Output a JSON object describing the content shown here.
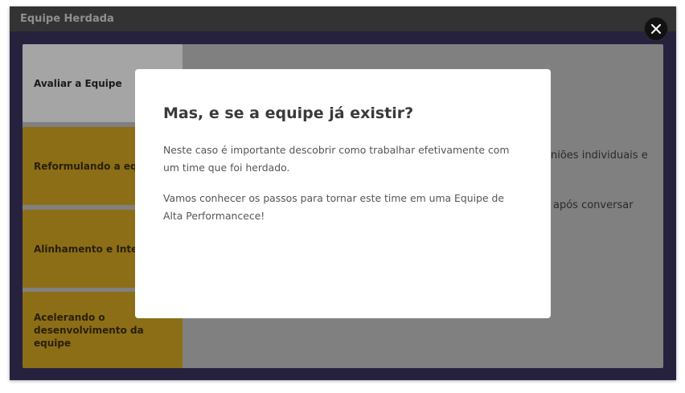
{
  "window": {
    "title": "Equipe Herdada"
  },
  "tabs": [
    {
      "label": "Avaliar a Equipe",
      "state": "active"
    },
    {
      "label": "Reformulando a equipe",
      "state": "inactive"
    },
    {
      "label": "Alinhamento e Integração",
      "state": "inactive"
    },
    {
      "label": "Acelerando o desenvolvimento da equipe",
      "state": "inactive"
    }
  ],
  "background_text": {
    "line1": "niões individuais e",
    "line2": "após conversar"
  },
  "modal": {
    "heading": "Mas, e se a equipe já existir?",
    "paragraph1": "Neste caso é  importante descobrir como trabalhar efetivamente com um time que foi herdado.",
    "paragraph2": "Vamos conhecer os passos para tornar este time em uma Equipe de Alta Performancece!"
  },
  "close": {
    "icon": "close-icon"
  },
  "colors": {
    "gold_tab": "#8c6e16",
    "panel_bg": "#26223e",
    "overlay_content": "#808080"
  }
}
